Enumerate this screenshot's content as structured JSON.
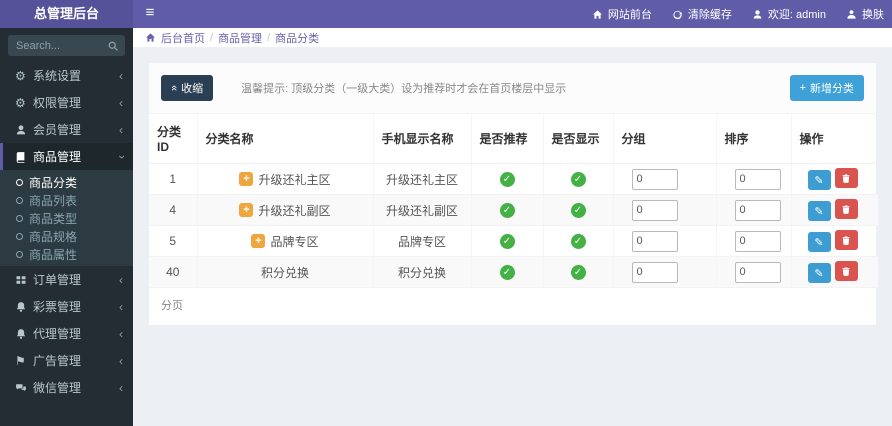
{
  "app": {
    "title": "总管理后台"
  },
  "icons": {
    "hamburger": "≡",
    "chevron": "‹",
    "collapse_arrows": "«",
    "gear": "⚙",
    "flag": "⚑",
    "check": "✓",
    "pencil": "✎",
    "plus": "+"
  },
  "topbar": {
    "links": [
      {
        "label": "网站前台",
        "icon": "home-icon"
      },
      {
        "label": "清除缓存",
        "icon": "refresh-icon"
      },
      {
        "label": "欢迎: admin",
        "icon": "user-icon"
      },
      {
        "label": "换肤",
        "icon": "skin-icon"
      }
    ]
  },
  "breadcrumb": {
    "sep": "/",
    "items": [
      "后台首页",
      "商品管理",
      "商品分类"
    ]
  },
  "sidebar": {
    "search_placeholder": "Search...",
    "menu": [
      {
        "label": "系统设置",
        "icon": "gear-icon"
      },
      {
        "label": "权限管理",
        "icon": "cogs-icon"
      },
      {
        "label": "会员管理",
        "icon": "user-icon"
      },
      {
        "label": "商品管理",
        "icon": "book-icon",
        "expanded": true,
        "children": [
          "商品分类",
          "商品列表",
          "商品类型",
          "商品规格",
          "商品属性"
        ],
        "active_child": "商品分类"
      },
      {
        "label": "订单管理",
        "icon": "list-icon"
      },
      {
        "label": "彩票管理",
        "icon": "bell-icon"
      },
      {
        "label": "代理管理",
        "icon": "bell-icon"
      },
      {
        "label": "广告管理",
        "icon": "flag-icon"
      },
      {
        "label": "微信管理",
        "icon": "comments-icon"
      }
    ]
  },
  "toolbar": {
    "collapse_label": "收缩",
    "tip": "温馨提示: 顶级分类（一级大类）设为推荐时才会在首页楼层中显示",
    "add_label": "新增分类"
  },
  "table": {
    "headers": [
      "分类ID",
      "分类名称",
      "手机显示名称",
      "是否推荐",
      "是否显示",
      "分组",
      "排序",
      "操作"
    ],
    "rows": [
      {
        "id": "1",
        "name": "升级还礼主区",
        "mobile_name": "升级还礼主区",
        "recommend": true,
        "show": true,
        "group": "0",
        "sort": "0"
      },
      {
        "id": "4",
        "name": "升级还礼副区",
        "mobile_name": "升级还礼副区",
        "recommend": true,
        "show": true,
        "group": "0",
        "sort": "0"
      },
      {
        "id": "5",
        "name": "品牌专区",
        "mobile_name": "品牌专区",
        "recommend": true,
        "show": true,
        "group": "0",
        "sort": "0"
      },
      {
        "id": "40",
        "name": "积分兑换",
        "mobile_name": "积分兑换",
        "recommend": true,
        "show": true,
        "group": "0",
        "sort": "0"
      }
    ],
    "footer": "分页"
  },
  "colors": {
    "navbar": "#605ca8",
    "logo": "#555299",
    "sidebar": "#232d33",
    "submenu": "#2c3b41",
    "accent_blue": "#3ea2d8",
    "collapse_btn": "#2a3f54",
    "success_green": "#43b143",
    "expand_orange": "#f0a63f",
    "edit_blue": "#3d9cd2",
    "delete_red": "#d9534f"
  }
}
